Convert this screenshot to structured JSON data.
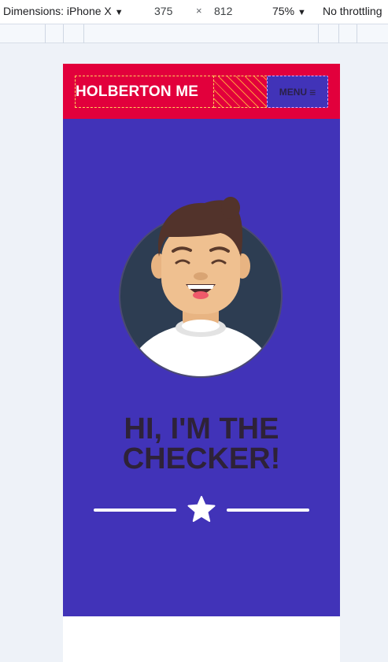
{
  "devtools": {
    "device_label": "Dimensions: iPhone X",
    "width": "375",
    "times": "×",
    "height": "812",
    "zoom": "75%",
    "throttling": "No throttling",
    "caret": "▼"
  },
  "header": {
    "logo": "HOLBERTON ME",
    "menu_label": "MENU",
    "menu_icon": "≡"
  },
  "hero": {
    "title_line1": "HI, I'M THE",
    "title_line2": "CHECKER!"
  },
  "icons": {
    "avatar": "smiling-person-avatar",
    "star": "star-icon",
    "menu": "hamburger-icon"
  },
  "colors": {
    "header_bg": "#e2003c",
    "hero_bg": "#4133b8",
    "title": "#2e2238",
    "logo_text": "#ffffff"
  }
}
